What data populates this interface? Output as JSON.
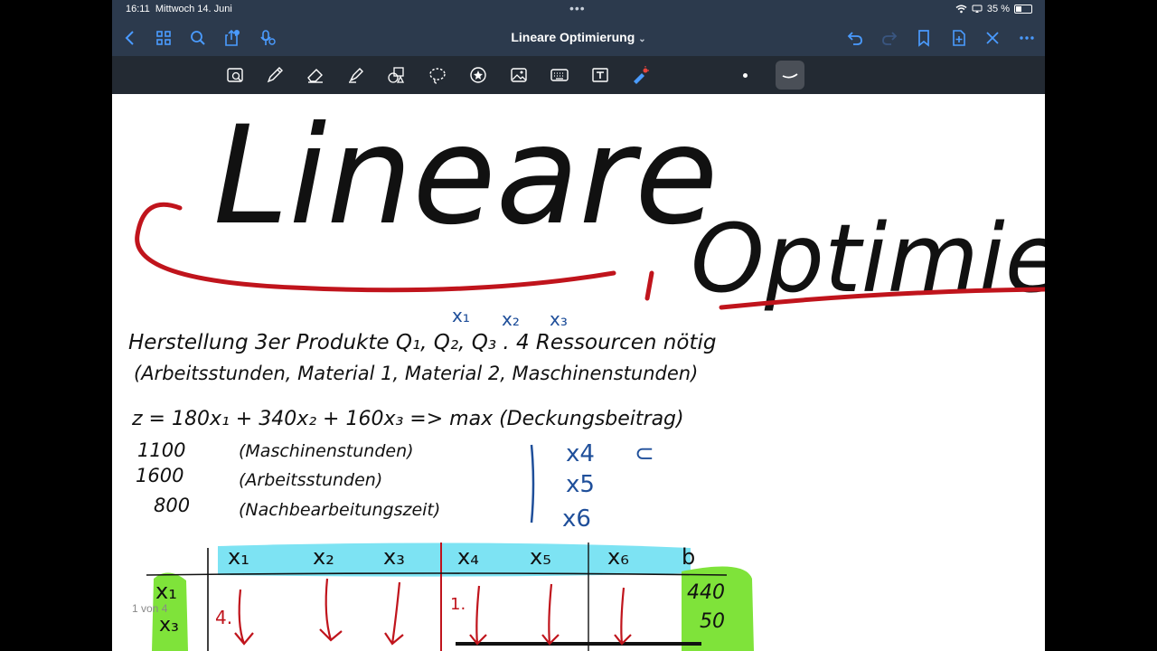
{
  "status_bar": {
    "time": "16:11",
    "date": "Mittwoch 14. Juni",
    "dots": "•••",
    "battery": "35 %"
  },
  "nav": {
    "title": "Lineare Optimierung",
    "title_chevron": "⌄",
    "left_icons": [
      "back-chevron-icon",
      "grid-icon",
      "search-icon",
      "share-icon",
      "microphone-icon"
    ],
    "right_icons": [
      "undo-icon",
      "redo-icon",
      "bookmark-icon",
      "add-page-icon",
      "close-icon",
      "more-icon"
    ]
  },
  "tools": [
    "lasso-zoom-icon",
    "pen-icon",
    "eraser-icon",
    "highlighter-icon",
    "shapes-icon",
    "lasso-icon",
    "sticker-icon",
    "image-icon",
    "keyboard-icon",
    "text-box-icon",
    "laser-pointer-icon"
  ],
  "colors": {
    "nav_bg": "#2c3a4d",
    "toolbar_bg": "#232a33",
    "accent": "#4a9bff",
    "ink_black": "#111111",
    "ink_red": "#c0141c",
    "ink_blue": "#1f4f9a",
    "highlight_cyan": "#7de3f3",
    "highlight_green": "#7fe33a"
  },
  "notes": {
    "title1": "Lineare",
    "title2": "Optimieru",
    "vars_top": [
      "x₁",
      "x₂",
      "x₃"
    ],
    "line1": "Herstellung 3er Produkte Q₁, Q₂, Q₃ . 4 Ressourcen nötig",
    "line2": "(Arbeitsstunden, Material 1, Material 2, Maschinenstunden)",
    "objective": "z = 180x₁ + 340x₂ + 160x₃ => max  (Deckungsbeitrag)",
    "constraints": [
      {
        "value": "1100",
        "label": "(Maschinenstunden)"
      },
      {
        "value": "1600",
        "label": "(Arbeitsstunden)"
      },
      {
        "value": "800",
        "label": "(Nachbearbeitungszeit)"
      }
    ],
    "slack_vars": [
      "x4",
      "x5",
      "x6"
    ],
    "slack_mark": "⊂",
    "table_headers": [
      "x₁",
      "x₂",
      "x₃",
      "x₄",
      "x₅",
      "x₆",
      "b"
    ],
    "row_labels": [
      "x₁",
      "x₃"
    ],
    "row_values": [
      "440",
      "50"
    ],
    "cell_marks": [
      "4.",
      "1."
    ]
  },
  "page_indicator": "1 von 4"
}
